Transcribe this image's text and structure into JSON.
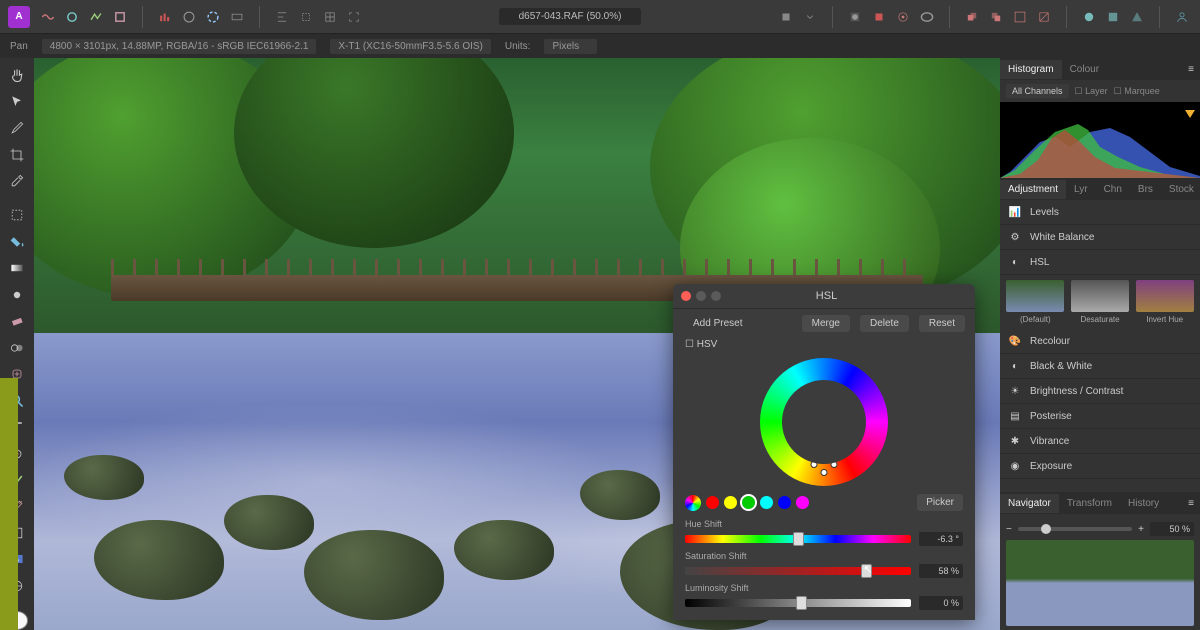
{
  "titlebar": {
    "filename": "d657-043.RAF (50.0%)"
  },
  "infobar": {
    "tool": "Pan",
    "dims": "4800 × 3101px, 14.88MP, RGBA/16 - sRGB IEC61966-2.1",
    "camera": "X-T1 (XC16-50mmF3.5-5.6 OIS)",
    "units_label": "Units:",
    "units_value": "Pixels"
  },
  "right": {
    "tabs1": {
      "histogram": "Histogram",
      "colour": "Colour"
    },
    "hist_controls": {
      "channels": "All Channels",
      "layer": "Layer",
      "marquee": "Marquee"
    },
    "tabs2": {
      "adjustment": "Adjustment",
      "lyr": "Lyr",
      "chn": "Chn",
      "brs": "Brs",
      "stock": "Stock"
    },
    "adjustments": {
      "levels": "Levels",
      "wb": "White Balance",
      "hsl": "HSL",
      "recolour": "Recolour",
      "bw": "Black & White",
      "bc": "Brightness / Contrast",
      "post": "Posterise",
      "vib": "Vibrance",
      "exp": "Exposure"
    },
    "presets": {
      "default": "(Default)",
      "desat": "Desaturate",
      "invert": "Invert Hue"
    },
    "tabs3": {
      "nav": "Navigator",
      "transform": "Transform",
      "history": "History"
    },
    "nav_zoom": "50 %"
  },
  "hsl": {
    "title": "HSL",
    "add_preset": "Add Preset",
    "merge": "Merge",
    "delete": "Delete",
    "reset": "Reset",
    "hsv": "HSV",
    "picker": "Picker",
    "hue_label": "Hue Shift",
    "hue_val": "-6.3 °",
    "sat_label": "Saturation Shift",
    "sat_val": "58 %",
    "lum_label": "Luminosity Shift",
    "lum_val": "0 %"
  },
  "swatches": [
    "#f00",
    "#ff0",
    "#0f0",
    "#0ff",
    "#00f",
    "#f0f"
  ]
}
